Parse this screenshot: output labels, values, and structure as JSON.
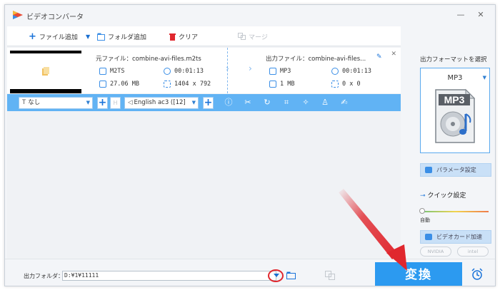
{
  "window": {
    "title": "ビデオコンバータ"
  },
  "toolbar": {
    "add_file": "ファイル追加",
    "add_folder": "フォルダ追加",
    "clear": "クリア",
    "merge": "マージ"
  },
  "file": {
    "source_label": "元ファイル：combine-avi-files.m2ts",
    "source_format": "M2TS",
    "source_duration": "00:01:13",
    "source_size": "27.06 MB",
    "source_resolution": "1404 x 792",
    "output_label": "出力ファイル：combine-avi-files...",
    "output_format": "MP3",
    "output_duration": "00:01:13",
    "output_size": "1 MB",
    "output_resolution": "0 x 0"
  },
  "editbar": {
    "subtitle_value": "なし",
    "audio_value": "English ac3 ([12]"
  },
  "right_panel": {
    "title": "出力フォーマットを選択",
    "format": "MP3",
    "format_icon_text": "MP3",
    "params_button": "パラメータ設定",
    "quick_settings": "クイック設定",
    "auto_label": "自動",
    "gpu_button": "ビデオカード加速",
    "nvidia": "NVIDIA",
    "intel": "intel"
  },
  "bottom": {
    "output_folder_label": "出力フォルダ：",
    "output_folder_value": "D:¥1¥11111",
    "convert": "変換"
  },
  "colors": {
    "accent": "#2c9af0",
    "editbar": "#61b3f4",
    "annotation": "#e0272e"
  }
}
